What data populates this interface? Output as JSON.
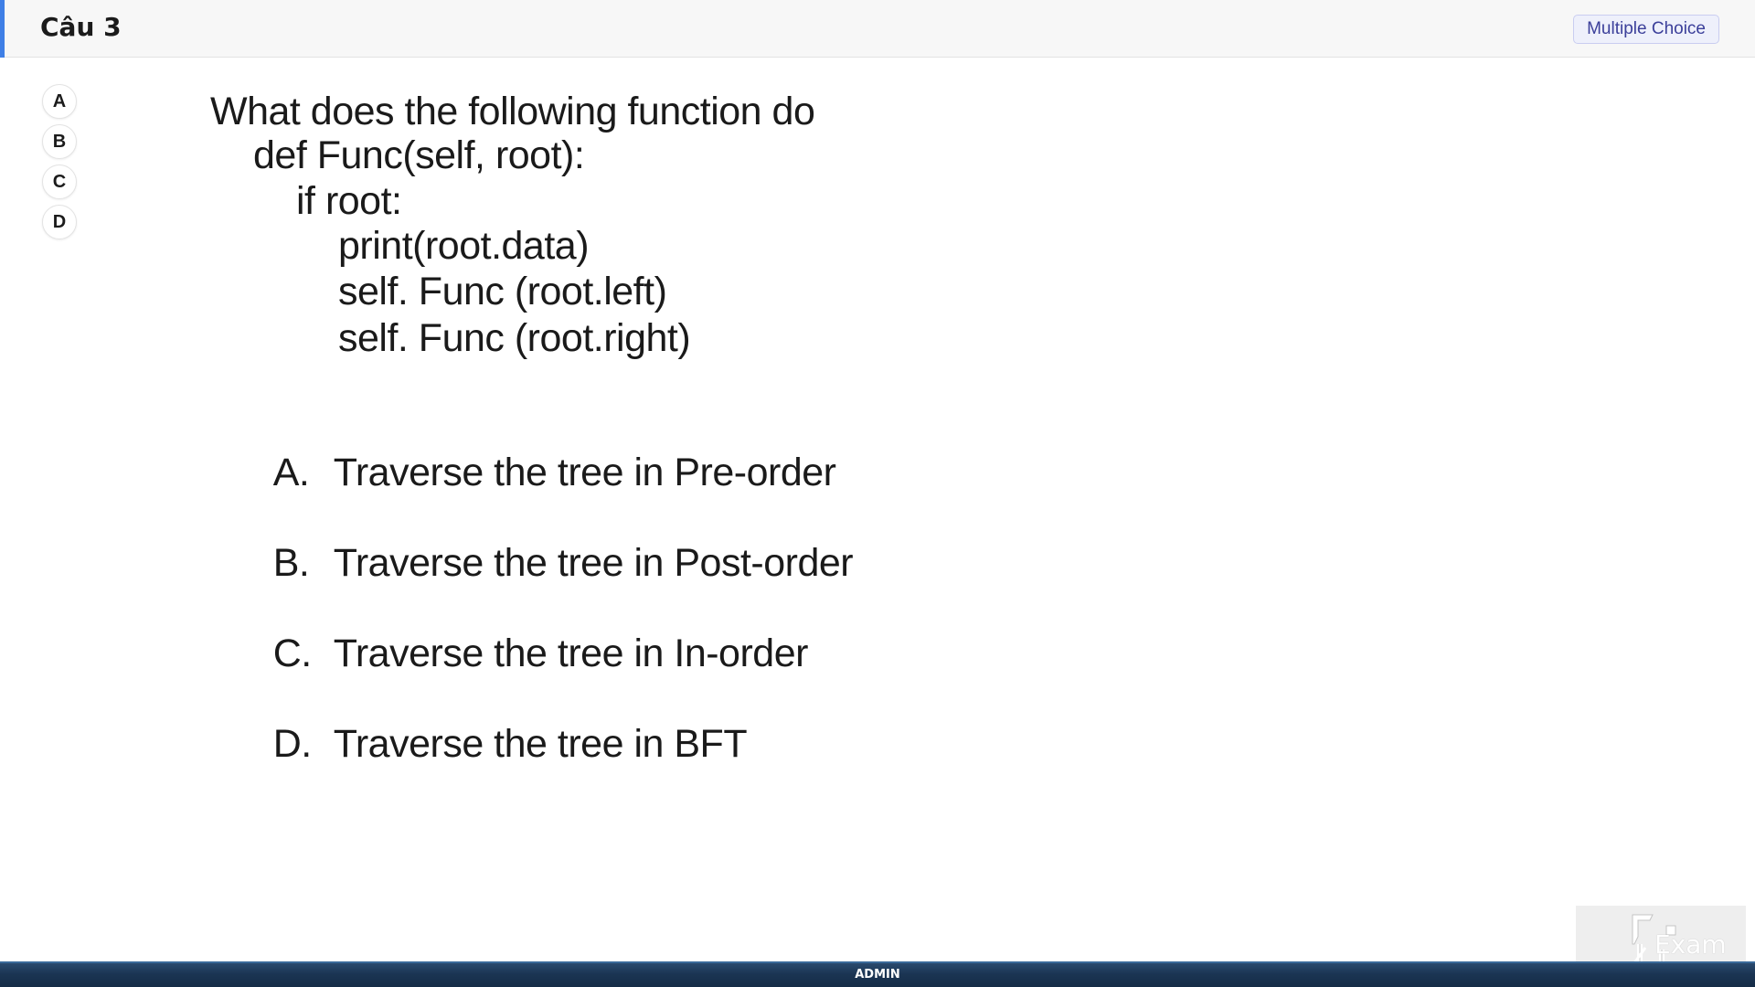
{
  "header": {
    "title": "Câu 3",
    "type_badge": "Multiple Choice",
    "accent_color": "#3f7fe6"
  },
  "answer_choices": [
    "A",
    "B",
    "C",
    "D"
  ],
  "question": {
    "stem_lines": [
      "What does the following function do",
      "def Func(self, root):",
      "if root:",
      "print(root.data)",
      "self. Func (root.left)",
      "self. Func (root.right)"
    ],
    "options": [
      {
        "letter": "A.",
        "text": "Traverse the tree in Pre-order"
      },
      {
        "letter": "B.",
        "text": "Traverse the tree in Post-order"
      },
      {
        "letter": "C.",
        "text": "Traverse the tree in In-order"
      },
      {
        "letter": "D.",
        "text": "Traverse the tree in BFT"
      }
    ]
  },
  "logo": {
    "text": "Exam",
    "icon": "fu-exam-logo-icon"
  },
  "footer": {
    "user_label": "ADMIN"
  }
}
